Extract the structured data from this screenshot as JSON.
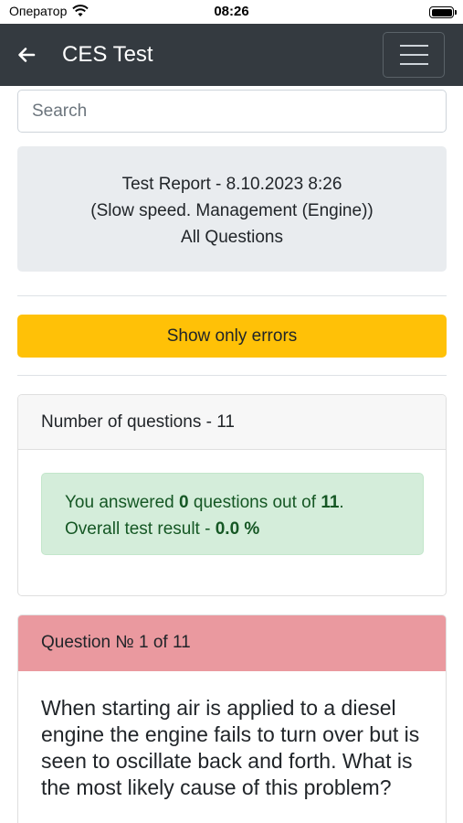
{
  "status_bar": {
    "carrier": "Оператор",
    "time": "08:26"
  },
  "navbar": {
    "title": "CES Test"
  },
  "search": {
    "placeholder": "Search"
  },
  "report": {
    "line1": "Test Report - 8.10.2023 8:26",
    "line2": "(Slow speed. Management (Engine))",
    "line3": "All Questions"
  },
  "errors_button": {
    "label": "Show only errors"
  },
  "summary": {
    "header": "Number of questions - 11",
    "answered_prefix": "You answered",
    "answered_count": "0",
    "answered_mid": "questions out of",
    "total": "11",
    "period": ".",
    "result_prefix": "Overall test result -",
    "result_value": "0.0 %"
  },
  "question": {
    "header": "Question № 1 of 11",
    "text": "When starting air is applied to a diesel engine the engine fails to turn over but is seen to oscillate back and forth. What is the most likely cause of this problem?"
  },
  "colors": {
    "navbar": "#343a40",
    "warning": "#ffc107",
    "success_bg": "#d4edda",
    "success_text": "#155724",
    "error_header": "#ea999f"
  }
}
